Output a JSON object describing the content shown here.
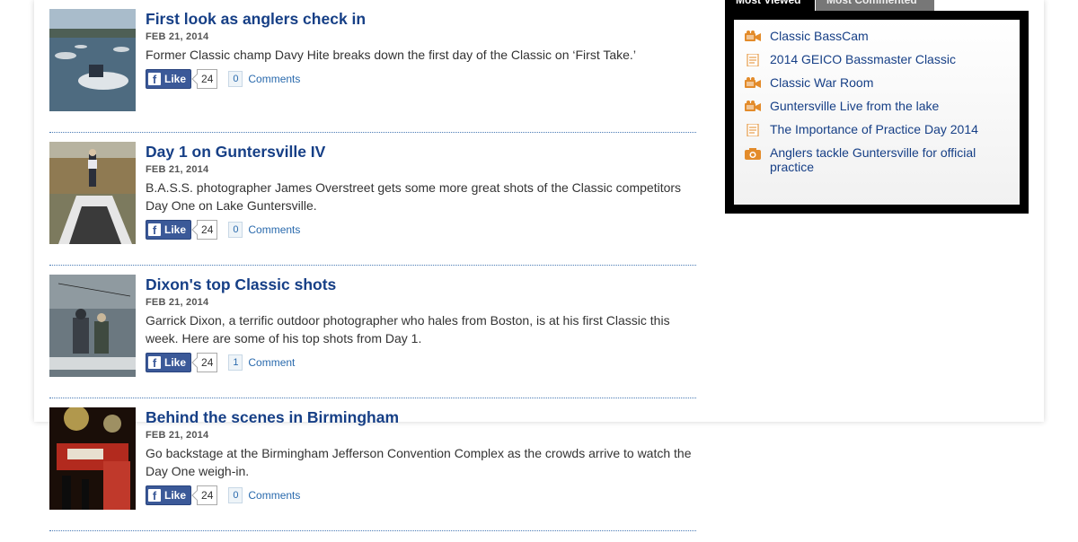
{
  "colors": {
    "title": "#163f86",
    "link": "#2a6aad",
    "fb_blue": "#3b5998",
    "icon_orange": "#e38b2a"
  },
  "widget": {
    "tabs": [
      "Most Viewed",
      "Most Commented"
    ],
    "items": [
      {
        "label": "Classic BassCam",
        "icon": "video-camera-icon"
      },
      {
        "label": "2014 GEICO Bassmaster Classic",
        "icon": "document-icon"
      },
      {
        "label": "Classic War Room",
        "icon": "video-camera-icon"
      },
      {
        "label": "Guntersville Live from the lake",
        "icon": "video-camera-icon"
      },
      {
        "label": "The Importance of Practice Day 2014",
        "icon": "document-icon"
      },
      {
        "label": "Anglers tackle Guntersville for official practice",
        "icon": "photo-camera-icon"
      }
    ]
  },
  "articles": [
    {
      "title": "First look as anglers check in",
      "date": "FEB 21, 2014",
      "description": "Former Classic champ Davy Hite breaks down the first day of the Classic on ‘First Take.’",
      "like_label": "Like",
      "like_count": "24",
      "comment_count": "0",
      "comment_label": "Comments"
    },
    {
      "title": "Day 1 on Guntersville IV",
      "date": "FEB 21, 2014",
      "description": "B.A.S.S. photographer James Overstreet gets some more great shots of the Classic competitors Day One on Lake Guntersville.",
      "like_label": "Like",
      "like_count": "24",
      "comment_count": "0",
      "comment_label": "Comments"
    },
    {
      "title": "Dixon's top Classic shots",
      "date": "FEB 21, 2014",
      "description": "Garrick Dixon, a terrific outdoor photographer who hales from Boston, is at his first Classic this week. Here are some of his top shots from Day 1.",
      "like_label": "Like",
      "like_count": "24",
      "comment_count": "1",
      "comment_label": "Comment"
    },
    {
      "title": "Behind the scenes in Birmingham",
      "date": "FEB 21, 2014",
      "description": "Go backstage at the Birmingham Jefferson Convention Complex as the crowds arrive to watch the Day One weigh-in.",
      "like_label": "Like",
      "like_count": "24",
      "comment_count": "0",
      "comment_label": "Comments"
    }
  ]
}
